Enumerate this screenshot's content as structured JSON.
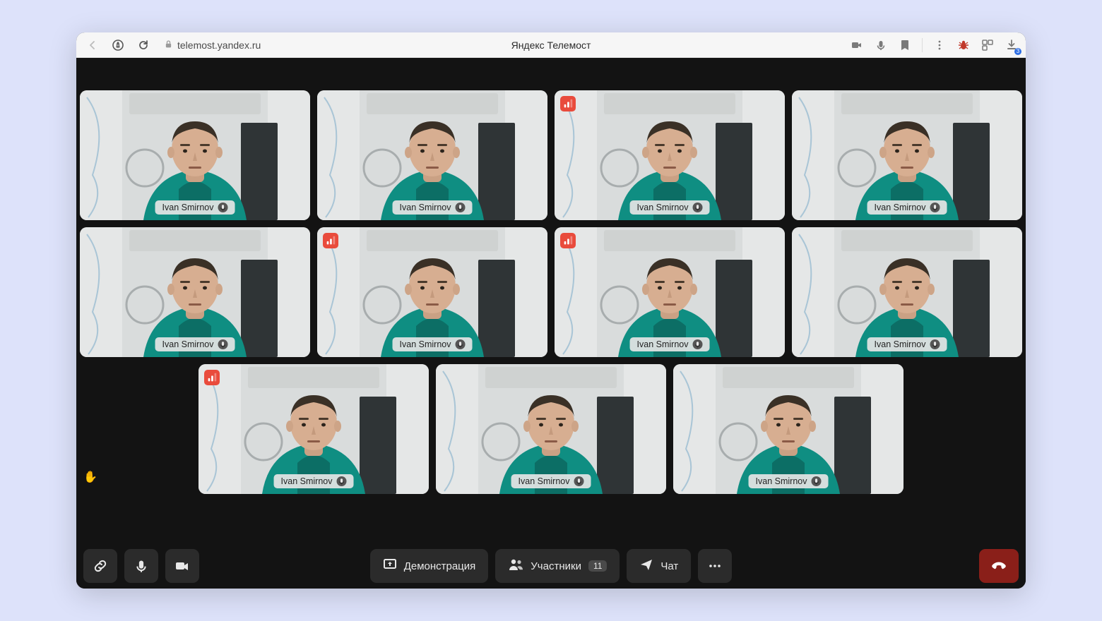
{
  "browser": {
    "url": "telemost.yandex.ru",
    "page_title": "Яндекс Телемост",
    "download_count": "3"
  },
  "participants": [
    {
      "name": "Ivan Smirnov",
      "poor_connection": false
    },
    {
      "name": "Ivan Smirnov",
      "poor_connection": false
    },
    {
      "name": "Ivan Smirnov",
      "poor_connection": true
    },
    {
      "name": "Ivan Smirnov",
      "poor_connection": false
    },
    {
      "name": "Ivan Smirnov",
      "poor_connection": false
    },
    {
      "name": "Ivan Smirnov",
      "poor_connection": true
    },
    {
      "name": "Ivan Smirnov",
      "poor_connection": true
    },
    {
      "name": "Ivan Smirnov",
      "poor_connection": false
    },
    {
      "name": "Ivan Smirnov",
      "poor_connection": true
    },
    {
      "name": "Ivan Smirnov",
      "poor_connection": false
    },
    {
      "name": "Ivan Smirnov",
      "poor_connection": false
    }
  ],
  "toolbar": {
    "share_label": "Демонстрация",
    "participants_label": "Участники",
    "participants_count": "11",
    "chat_label": "Чат"
  }
}
